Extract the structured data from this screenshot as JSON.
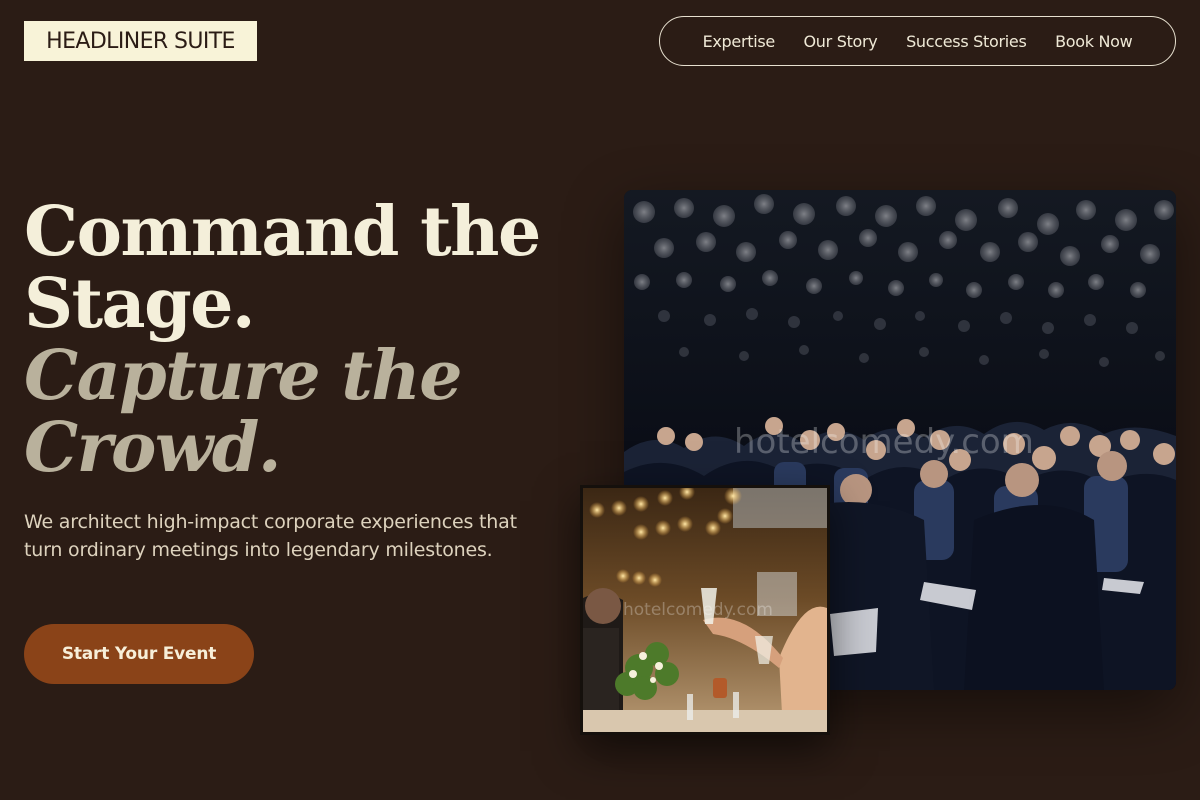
{
  "brand": {
    "logo_text": "HEADLINER SUITE"
  },
  "nav": {
    "items": [
      {
        "label": "Expertise"
      },
      {
        "label": "Our Story"
      },
      {
        "label": "Success Stories"
      },
      {
        "label": "Book Now"
      }
    ]
  },
  "hero": {
    "headline_line1": "Command the",
    "headline_line2": "Stage.",
    "headline_italic_line1": "Capture the",
    "headline_italic_line2": "Crowd.",
    "description": "We architect high-impact corporate experiences that turn ordinary meetings into legendary milestones.",
    "cta_label": "Start Your Event"
  },
  "images": {
    "main_watermark": "hotelcomedy.com",
    "small_watermark": "hotelcomedy.com"
  },
  "colors": {
    "background": "#2b1c15",
    "logo_bg": "#f8f3d8",
    "cta_bg": "#8a4318",
    "headline": "#f4efda",
    "headline_italic": "#b9b19c"
  }
}
